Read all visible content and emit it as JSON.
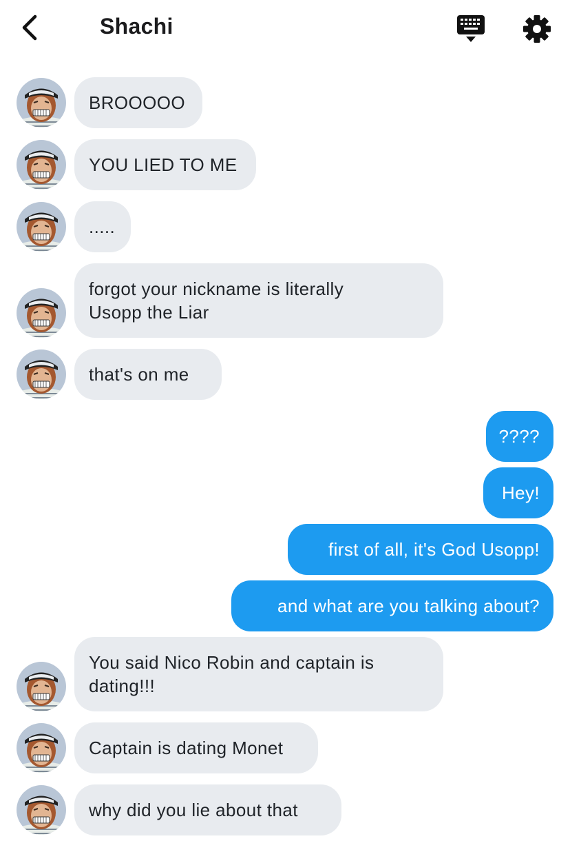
{
  "header": {
    "title": "Shachi",
    "back_icon": "chevron-left-icon",
    "keyboard_icon": "keyboard-icon",
    "settings_icon": "gear-icon"
  },
  "colors": {
    "incoming_bubble": "#e8ebef",
    "outgoing_bubble": "#1d9bf0",
    "outgoing_text": "#ffffff",
    "incoming_text": "#1f2328"
  },
  "messages": [
    {
      "from": "them",
      "text": "BROOOOO"
    },
    {
      "from": "them",
      "text": "YOU LIED TO ME"
    },
    {
      "from": "them",
      "text": "....."
    },
    {
      "from": "them",
      "text": "forgot your nickname is literally\nUsopp the Liar"
    },
    {
      "from": "them",
      "text": "that's on me"
    },
    {
      "from": "me",
      "text": "????"
    },
    {
      "from": "me",
      "text": "Hey!"
    },
    {
      "from": "me",
      "text": "first of all, it's God Usopp!"
    },
    {
      "from": "me",
      "text": "and what are you talking about?"
    },
    {
      "from": "them",
      "text": "You said Nico Robin and captain is\ndating!!!"
    },
    {
      "from": "them",
      "text": "Captain is dating Monet"
    },
    {
      "from": "them",
      "text": "why did you lie about that"
    }
  ]
}
